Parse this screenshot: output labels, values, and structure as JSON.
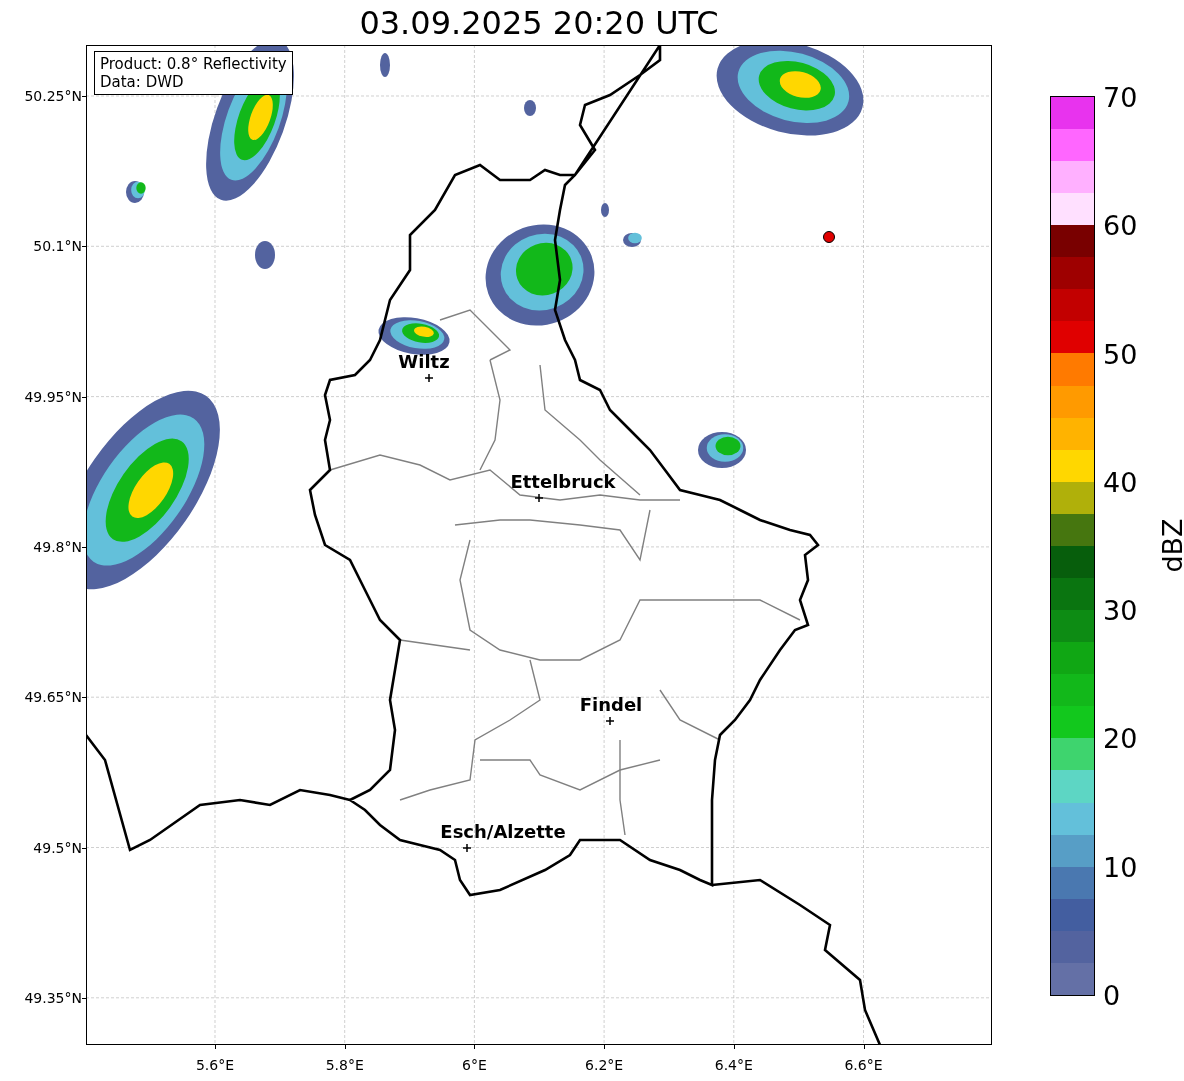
{
  "title": "03.09.2025 20:20 UTC",
  "legend": {
    "lines": [
      "Product: 0.8° Reflectivity",
      "Data: DWD"
    ]
  },
  "axes": {
    "yticks": [
      "50.25°N",
      "50.1°N",
      "49.95°N",
      "49.8°N",
      "49.65°N",
      "49.5°N",
      "49.35°N"
    ],
    "xticks": [
      "5.6°E",
      "5.8°E",
      "6°E",
      "6.2°E",
      "6.4°E",
      "6.6°E"
    ]
  },
  "cities": [
    {
      "name": "Wiltz"
    },
    {
      "name": "Ettelbruck"
    },
    {
      "name": "Findel"
    },
    {
      "name": "Esch/Alzette"
    }
  ],
  "colorbar": {
    "label": "dBZ",
    "ticks": [
      "70",
      "60",
      "50",
      "40",
      "30",
      "20",
      "10",
      "0"
    ],
    "bins": [
      {
        "color": "#6470a6"
      },
      {
        "color": "#53639f"
      },
      {
        "color": "#435ea0"
      },
      {
        "color": "#4a78b0"
      },
      {
        "color": "#579ec6"
      },
      {
        "color": "#63c0da"
      },
      {
        "color": "#5dd6c4"
      },
      {
        "color": "#3ed46e"
      },
      {
        "color": "#12c81d"
      },
      {
        "color": "#12b81a"
      },
      {
        "color": "#10a714"
      },
      {
        "color": "#0d8c14"
      },
      {
        "color": "#0a7510"
      },
      {
        "color": "#075e0c"
      },
      {
        "color": "#46760f"
      },
      {
        "color": "#b0b00a"
      },
      {
        "color": "#ffd700"
      },
      {
        "color": "#ffb300"
      },
      {
        "color": "#ff9a00"
      },
      {
        "color": "#ff7a00"
      },
      {
        "color": "#e00000"
      },
      {
        "color": "#c20000"
      },
      {
        "color": "#9e0000"
      },
      {
        "color": "#790000"
      },
      {
        "color": "#ffe0ff"
      },
      {
        "color": "#ffb0ff"
      },
      {
        "color": "#ff66ff"
      },
      {
        "color": "#e833ee"
      }
    ]
  }
}
